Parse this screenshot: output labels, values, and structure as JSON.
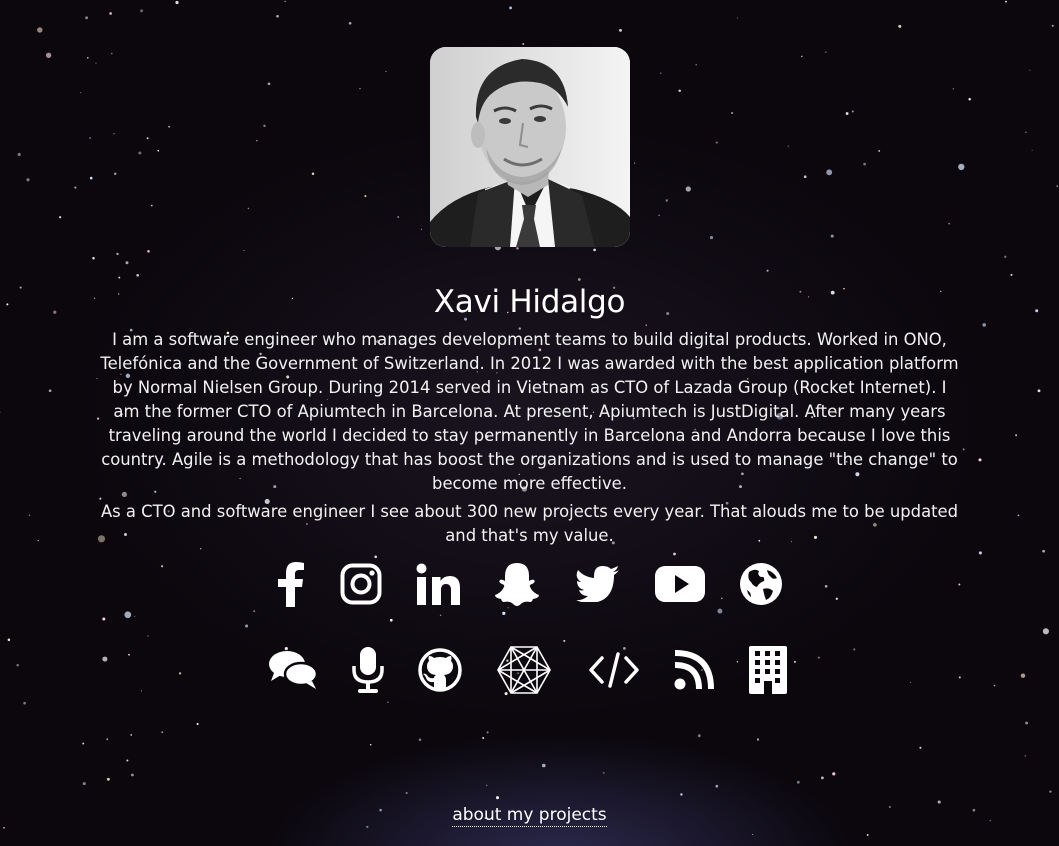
{
  "profile": {
    "name": "Xavi Hidalgo",
    "bio_paragraph_1": "I am a software engineer who manages development teams to build digital products. Worked in ONO, Telefónica and the Government of Switzerland. In 2012 I was awarded with the best application platform by Normal Nielsen Group. During 2014 served in Vietnam as CTO of Lazada Group (Rocket Internet). I am the former CTO of Apiumtech in Barcelona. At present, Apiumtech is JustDigital. After many years traveling around the world I decided to stay permanently in Barcelona and Andorra because I love this country. Agile is a methodology that has boost the organizations and is used to manage \"the change\" to become more effective.",
    "bio_paragraph_2": "As a CTO and software engineer I see about 300 new projects every year. That alouds me to be updated and that's my value."
  },
  "social_row_1": [
    {
      "icon": "facebook-icon"
    },
    {
      "icon": "instagram-icon"
    },
    {
      "icon": "linkedin-icon"
    },
    {
      "icon": "snapchat-icon"
    },
    {
      "icon": "twitter-icon"
    },
    {
      "icon": "youtube-icon"
    },
    {
      "icon": "globe-icon"
    }
  ],
  "social_row_2": [
    {
      "icon": "comments-icon"
    },
    {
      "icon": "microphone-icon"
    },
    {
      "icon": "github-icon"
    },
    {
      "icon": "hexagon-network-icon"
    },
    {
      "icon": "code-icon"
    },
    {
      "icon": "rss-icon"
    },
    {
      "icon": "building-icon"
    }
  ],
  "footer": {
    "link_label": "about my projects"
  },
  "colors": {
    "background": "#0b070d",
    "text": "#ffffff"
  }
}
